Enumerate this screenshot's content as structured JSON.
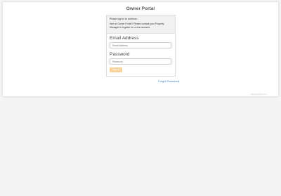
{
  "header": {
    "title": "Owner Portal"
  },
  "panel": {
    "intro_line": "Please sign in to continue...",
    "new_user_message": "New to Owner Portal? Please contact your Property Manager to register for a new account."
  },
  "form": {
    "email_label": "Email Address",
    "email_placeholder": "Email Address",
    "password_label": "Password",
    "password_placeholder": "Password",
    "submit_label": "Sign In"
  },
  "links": {
    "forgot_password": "Forgot Password"
  },
  "footer": {
    "text": "www.appfolio.com"
  },
  "colors": {
    "submit_button": "#f9d29a",
    "link": "#3a7fc1"
  }
}
